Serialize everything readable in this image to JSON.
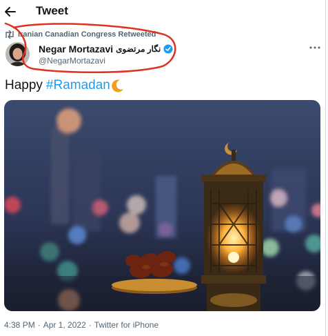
{
  "header": {
    "title": "Tweet",
    "back_icon": "arrow-left-icon"
  },
  "retweet": {
    "icon": "retweet-icon",
    "text": "Iranian Canadian Congress Retweeted"
  },
  "author": {
    "display_name": "Negar Mortazavi",
    "display_name_fa": "نگار مرتضوی",
    "handle": "@NegarMortazavi",
    "verified_icon": "verified-badge-icon",
    "more_icon": "more-horizontal-icon"
  },
  "tweet": {
    "text_prefix": "Happy",
    "hashtag": "#Ramadan",
    "emoji_icon": "crescent-moon-icon"
  },
  "media": {
    "subject": "lantern-and-dates-photo"
  },
  "meta": {
    "time": "4:38 PM",
    "separator1": "·",
    "date": "Apr 1, 2022",
    "separator2": "·",
    "source": "Twitter for iPhone"
  },
  "colors": {
    "accent": "#1d9bf0",
    "secondary_text": "#536471",
    "annotation": "#e0301e"
  }
}
